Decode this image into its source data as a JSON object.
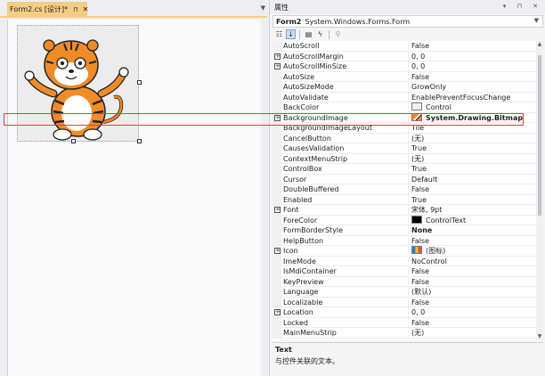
{
  "designer": {
    "tab_label": "Form2.cs [设计]*",
    "pin_glyph": "⊓",
    "close_glyph": "✕",
    "dropdown_glyph": "▼"
  },
  "properties": {
    "title": "属性",
    "window_tools": "▾ ⊓ ✕",
    "object_name": "Form2",
    "object_type": "System.Windows.Forms.Form",
    "rows": [
      {
        "name": "AutoScroll",
        "value": "False",
        "expander": ""
      },
      {
        "name": "AutoScrollMargin",
        "value": "0, 0",
        "expander": "+"
      },
      {
        "name": "AutoScrollMinSize",
        "value": "0, 0",
        "expander": "+"
      },
      {
        "name": "AutoSize",
        "value": "False",
        "expander": ""
      },
      {
        "name": "AutoSizeMode",
        "value": "GrowOnly",
        "expander": ""
      },
      {
        "name": "AutoValidate",
        "value": "EnablePreventFocusChange",
        "expander": ""
      },
      {
        "name": "BackColor",
        "value": "Control",
        "expander": "",
        "swatch": "#f0f0f0"
      },
      {
        "name": "BackgroundImage",
        "value": "System.Drawing.Bitmap",
        "expander": "+",
        "bold": true,
        "icon": "bitmap-thumb"
      },
      {
        "name": "BackgroundImageLayout",
        "value": "Tile",
        "expander": ""
      },
      {
        "name": "CancelButton",
        "value": "(无)",
        "expander": ""
      },
      {
        "name": "CausesValidation",
        "value": "True",
        "expander": ""
      },
      {
        "name": "ContextMenuStrip",
        "value": "(无)",
        "expander": ""
      },
      {
        "name": "ControlBox",
        "value": "True",
        "expander": ""
      },
      {
        "name": "Cursor",
        "value": "Default",
        "expander": ""
      },
      {
        "name": "DoubleBuffered",
        "value": "False",
        "expander": ""
      },
      {
        "name": "Enabled",
        "value": "True",
        "expander": ""
      },
      {
        "name": "Font",
        "value": "宋体, 9pt",
        "expander": "+"
      },
      {
        "name": "ForeColor",
        "value": "ControlText",
        "expander": "",
        "swatch": "#000000"
      },
      {
        "name": "FormBorderStyle",
        "value": "None",
        "expander": "",
        "bold": true
      },
      {
        "name": "HelpButton",
        "value": "False",
        "expander": ""
      },
      {
        "name": "Icon",
        "value": "(图标)",
        "expander": "+",
        "icon": "icon-thumb"
      },
      {
        "name": "ImeMode",
        "value": "NoControl",
        "expander": ""
      },
      {
        "name": "IsMdiContainer",
        "value": "False",
        "expander": ""
      },
      {
        "name": "KeyPreview",
        "value": "False",
        "expander": ""
      },
      {
        "name": "Language",
        "value": "(默认)",
        "expander": ""
      },
      {
        "name": "Localizable",
        "value": "False",
        "expander": ""
      },
      {
        "name": "Location",
        "value": "0, 0",
        "expander": "+"
      },
      {
        "name": "Locked",
        "value": "False",
        "expander": ""
      },
      {
        "name": "MainMenuStrip",
        "value": "(无)",
        "expander": ""
      }
    ],
    "description_title": "Text",
    "description_text": "与控件关联的文本。"
  },
  "colors": {
    "tab_accent": "#f5cc84",
    "highlight": "#e04040"
  }
}
